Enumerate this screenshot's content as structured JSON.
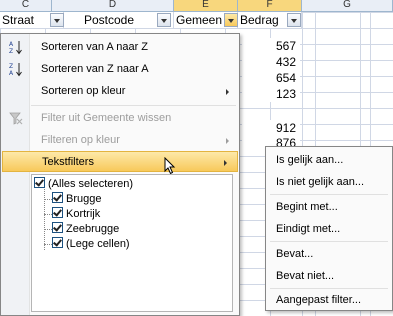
{
  "sheet": {
    "column_letters": [
      "C",
      "D",
      "E",
      "F",
      "G"
    ],
    "headers": [
      "Straat",
      "Postcode",
      "Gemeen",
      "Bedrag"
    ],
    "bedrag_values": [
      "567",
      "432",
      "654",
      "123",
      "912",
      "876"
    ]
  },
  "menu": {
    "sort_az": "Sorteren van A naar Z",
    "sort_za": "Sorteren van Z naar A",
    "sort_color": "Sorteren op kleur",
    "clear_filter": "Filter uit Gemeente wissen",
    "filter_color": "Filteren op kleur",
    "text_filters": "Tekstfilters",
    "list_items": [
      "(Alles selecteren)",
      "Brugge",
      "Kortrijk",
      "Zeebrugge",
      "(Lege cellen)"
    ]
  },
  "submenu": {
    "items": [
      "Is gelijk aan...",
      "Is niet gelijk aan...",
      "Begint met...",
      "Eindigt met...",
      "Bevat...",
      "Bevat niet...",
      "Aangepast filter..."
    ]
  }
}
